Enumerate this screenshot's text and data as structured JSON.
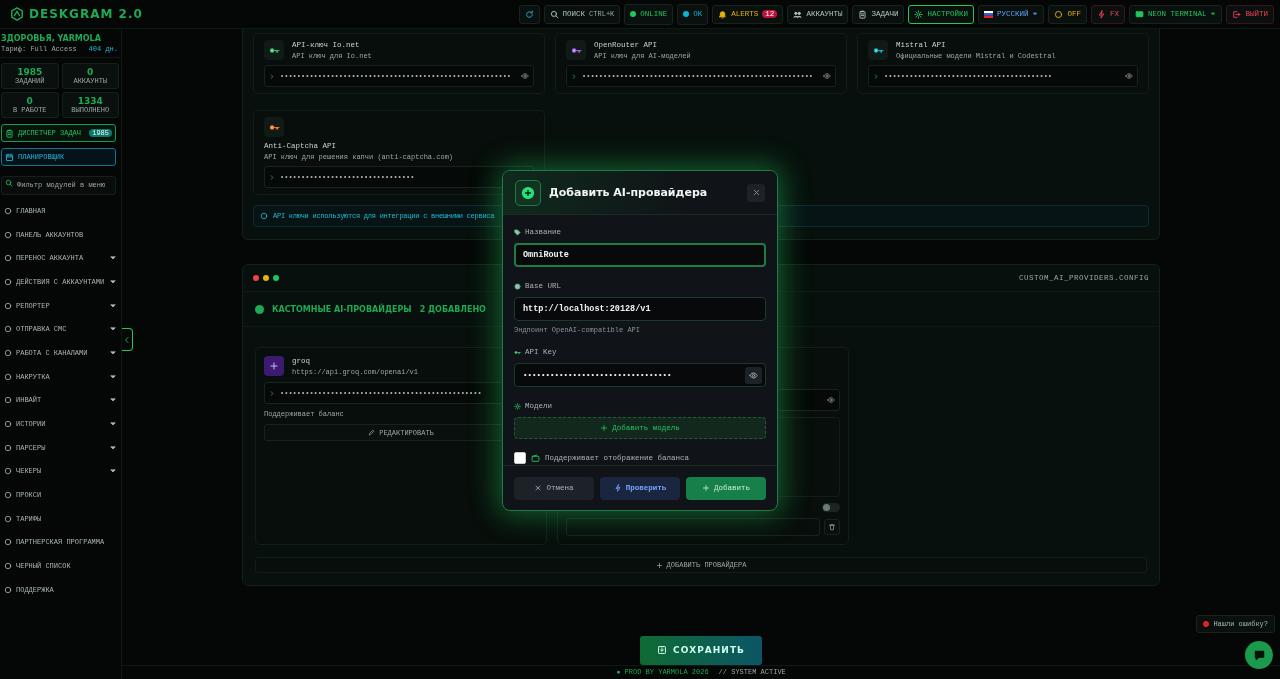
{
  "topbar": {
    "logo": "DESKGRAM 2.0",
    "items": [
      {
        "kind": "refresh",
        "selected": false
      },
      {
        "kind": "search",
        "label": "ПОИСК",
        "shortcut": "CTRL+K",
        "selected": false
      },
      {
        "kind": "status",
        "label": "ONLINE",
        "color": "#22c55e",
        "selected": false
      },
      {
        "kind": "status",
        "label": "OK",
        "color": "#06b6d4",
        "selected": false
      },
      {
        "kind": "alerts",
        "label": "ALERTS",
        "badge": "12",
        "selected": false
      },
      {
        "kind": "nav",
        "label": "АККАУНТЫ",
        "selected": false
      },
      {
        "kind": "nav",
        "label": "ЗАДАЧИ",
        "selected": false
      },
      {
        "kind": "nav",
        "label": "НАСТРОЙКИ",
        "selected": true
      },
      {
        "kind": "lang",
        "label": "РУССКИЙ",
        "selected": false
      },
      {
        "kind": "toggle",
        "label": "OFF",
        "selected": false
      },
      {
        "kind": "fx",
        "label": "FX",
        "selected": false
      },
      {
        "kind": "theme",
        "label": "NEON TERMINAL",
        "selected": false
      },
      {
        "kind": "logout",
        "label": "ВЫЙТИ",
        "selected": false
      }
    ]
  },
  "sidebar": {
    "user": "ЗДОРОВЬЯ, YARMOLA",
    "plan": "Тариф: Full Access",
    "days": "404 дн.",
    "stats": [
      {
        "value": "1985",
        "label": "ЗАДАНИЙ"
      },
      {
        "value": "0",
        "label": "АККАУНТЫ"
      },
      {
        "value": "0",
        "label": "В РАБОТЕ"
      },
      {
        "value": "1334",
        "label": "ВЫПОЛНЕНО"
      }
    ],
    "task_button": {
      "label": "ДИСПЕТЧЕР ЗАДАЧ",
      "badge": "1985"
    },
    "planner_button": {
      "label": "ПЛАНИРОВЩИК"
    },
    "filter": {
      "placeholder": "Фильтр модулей в меню"
    },
    "items": [
      {
        "label": "ГЛАВНАЯ",
        "expandable": false
      },
      {
        "label": "ПАНЕЛЬ АККАУНТОВ",
        "expandable": false
      },
      {
        "label": "ПЕРЕНОС АККАУНТА",
        "expandable": true
      },
      {
        "label": "ДЕЙСТВИЯ С АККАУНТАМИ",
        "expandable": true
      },
      {
        "label": "РЕПОРТЕР",
        "expandable": true
      },
      {
        "label": "ОТПРАВКА СМС",
        "expandable": true
      },
      {
        "label": "РАБОТА С КАНАЛАМИ",
        "expandable": true
      },
      {
        "label": "НАКРУТКА",
        "expandable": true
      },
      {
        "label": "ИНВАЙТ",
        "expandable": true
      },
      {
        "label": "ИСТОРИИ",
        "expandable": true
      },
      {
        "label": "ПАРСЕРЫ",
        "expandable": true
      },
      {
        "label": "ЧЕКЕРЫ",
        "expandable": true
      },
      {
        "label": "ПРОКСИ",
        "expandable": false
      },
      {
        "label": "ТАРИФЫ",
        "expandable": false
      },
      {
        "label": "ПАРТНЕРСКАЯ ПРОГРАММА",
        "expandable": false
      },
      {
        "label": "ЧЕРНЫЙ СПИСОК",
        "expandable": false
      },
      {
        "label": "ПОДДЕРЖКА",
        "expandable": false
      }
    ]
  },
  "api_keys": {
    "cards": [
      {
        "kind": "inline",
        "title": "API-ключ Io.net",
        "subtitle": "API ключ для Io.net",
        "key": "•••••••••••••••••••••••••••••••••••••••••••••••••••••••",
        "color": "#22c55e"
      },
      {
        "kind": "inline",
        "title": "OpenRouter API",
        "subtitle": "API ключ для AI-моделей",
        "key": "•••••••••••••••••••••••••••••••••••••••••••••••••••••••",
        "color": "#a855f7"
      },
      {
        "kind": "inline",
        "title": "Mistral API",
        "subtitle": "Официальные модели Mistral и Codestral",
        "key": "••••••••••••••••••••••••••••••••••••••••",
        "color": "#06b6d4"
      },
      {
        "kind": "stacked",
        "title": "Anti-Captcha API",
        "subtitle": "API ключ для решения капчи (anti-captcha.com)",
        "key": "••••••••••••••••••••••••••••••••",
        "color": "#f97316"
      }
    ],
    "note": "API ключи используются для интеграции с внешними сервиса"
  },
  "config": {
    "file": "CUSTOM_AI_PROVIDERS.CONFIG",
    "title": "КАСТОМНЫЕ AI-ПРОВАЙДЕРЫ",
    "count": "2 ДОБАВЛЕНО",
    "provider": {
      "name": "groq",
      "url": "https://api.groq.com/openai/v1",
      "key": "••••••••••••••••••••••••••••••••••••••••••••••••",
      "note": "Поддерживает баланс",
      "edit": "РЕДАКТИРОВАТЬ"
    },
    "second_provider": {
      "on": false
    },
    "add_button": "ДОБАВИТЬ ПРОВАЙДЕРА"
  },
  "save_button": "СОХРАНИТЬ",
  "footer": {
    "left": "● PROD BY YARMOLA 2026",
    "right": "// SYSTEM ACTIVE"
  },
  "bug_report": "Нашли ошибку?",
  "modal": {
    "title": "Добавить AI-провайдера",
    "fields": [
      {
        "kind": "text",
        "label": "Название",
        "value": "OmniRoute",
        "focused": true
      },
      {
        "kind": "text",
        "label": "Base URL",
        "value": "http://localhost:20128/v1",
        "hint": "Эндпоинт OpenAI-compatible API",
        "focused": false
      },
      {
        "kind": "secret",
        "label": "API Key",
        "value": "•••••••••••••••••••••••••••••••••",
        "focused": false
      },
      {
        "kind": "models",
        "label": "Модели",
        "button": "Добавить модель"
      }
    ],
    "balance": {
      "label": "Поддерживает отображение баланса",
      "checked": false
    },
    "buttons": [
      {
        "kind": "cancel",
        "label": "Отмена"
      },
      {
        "kind": "check",
        "label": "Проверить"
      },
      {
        "kind": "add",
        "label": "Добавить"
      }
    ]
  }
}
